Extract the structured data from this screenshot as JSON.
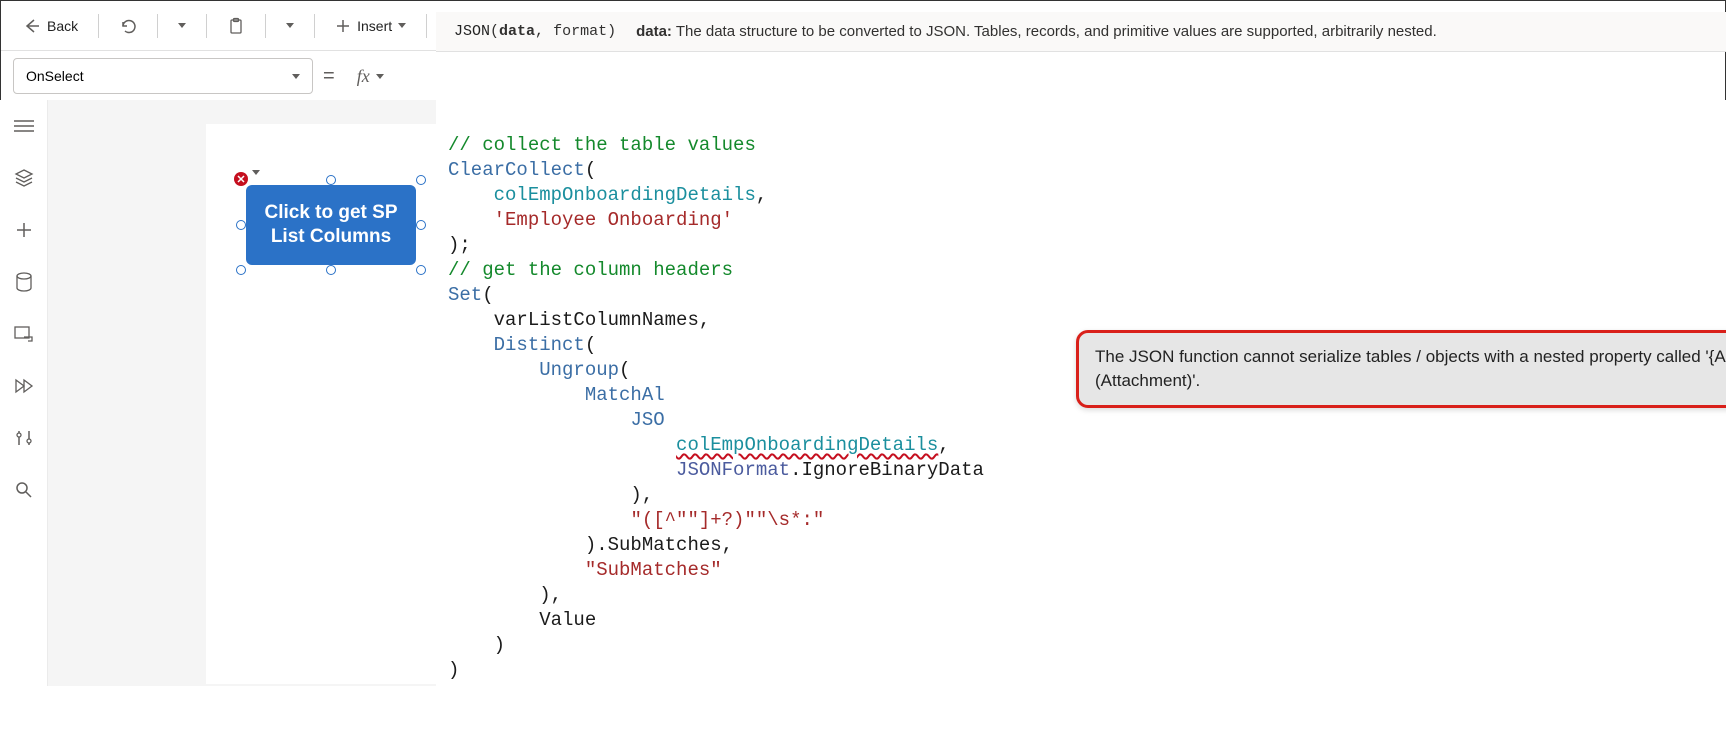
{
  "toolbar": {
    "back_label": "Back",
    "insert_label": "Insert"
  },
  "hint": {
    "signature_fn": "JSON",
    "signature_p1": "data",
    "signature_p2": "format",
    "param_name": "data:",
    "param_desc": "The data structure to be converted to JSON. Tables, records, and primitive values are supported, arbitrarily nested."
  },
  "property": {
    "selected": "OnSelect"
  },
  "canvas": {
    "button_label": "Click to get SP List Columns"
  },
  "code": {
    "l1": "// collect the table values",
    "l2a": "ClearCollect",
    "l2b": "(",
    "l3a": "    ",
    "l3b": "colEmpOnboardingDetails",
    "l3c": ",",
    "l4a": "    ",
    "l4b": "'Employee Onboarding'",
    "l5": ");",
    "l6": "// get the column headers",
    "l7a": "Set",
    "l7b": "(",
    "l8": "    varListColumnNames,",
    "l9a": "    ",
    "l9b": "Distinct",
    "l9c": "(",
    "l10a": "        ",
    "l10b": "Ungroup",
    "l10c": "(",
    "l11a": "            ",
    "l11b": "MatchAl",
    "l12a": "                ",
    "l12b": "JSO",
    "l13a": "                    ",
    "l13b": "colEmpOnboardingDetails",
    "l13c": ",",
    "l14a": "                    ",
    "l14b": "JSONFormat",
    "l14c": ".IgnoreBinaryData",
    "l15": "                ),",
    "l16a": "                ",
    "l16b": "\"([^\"\"]+?)\"\"\\s*:\"",
    "l17": "            ).SubMatches,",
    "l18a": "            ",
    "l18b": "\"SubMatches\"",
    "l19": "        ),",
    "l20": "        Value",
    "l21": "    )",
    "l22": ")"
  },
  "error": {
    "message": "The JSON function cannot serialize tables / objects with a nested property called '{Attachments}' of type 'Table (Attachment)'."
  }
}
